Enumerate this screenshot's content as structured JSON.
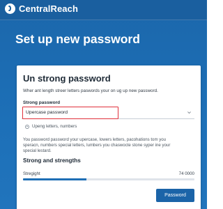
{
  "app": {
    "brand": "CentralReach",
    "logo_icon": "centralreach-logo-icon"
  },
  "page": {
    "title": "Set up new password"
  },
  "card": {
    "title": "Un strong password",
    "description": "Wher ant length streer letters paswords your on ug up new password.",
    "field_label": "Strong password",
    "select_value": "Upercase password",
    "hint": "Upeng letters, numbers",
    "body_lines": [
      "You password password your upercase, lowers letters, pacohations tom you",
      "speracn, numbers special letters, lumbers you chaswocte stone syper ine your",
      "special lestard."
    ],
    "strength_title": "Strong and strengths",
    "strength_label": "Stregight",
    "strength_count": "74 0000",
    "strength_fraction": 0.37,
    "submit_label": "Password"
  },
  "colors": {
    "header_blue": "#1d70b8",
    "highlight_red": "#e0303a",
    "button_blue": "#1b64a8",
    "meter_fill": "#1e6fb5"
  }
}
